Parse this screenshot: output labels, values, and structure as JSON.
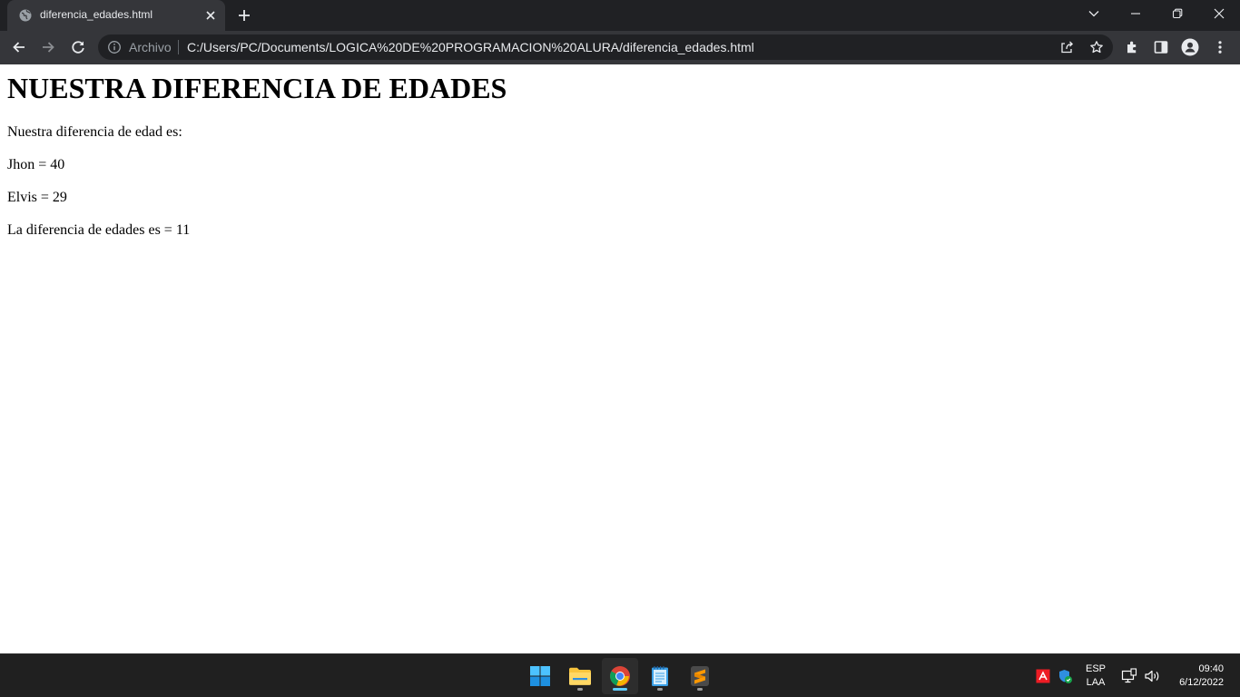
{
  "browser": {
    "tab": {
      "title": "diferencia_edades.html",
      "favicon": "globe-icon"
    },
    "omnibox": {
      "scheme_label": "Archivo",
      "url": "C:/Users/PC/Documents/LOGICA%20DE%20PROGRAMACION%20ALURA/diferencia_edades.html"
    }
  },
  "page": {
    "heading": "NUESTRA DIFERENCIA DE EDADES",
    "paragraphs": [
      "Nuestra diferencia de edad es:",
      "Jhon = 40",
      "Elvis = 29",
      "La diferencia de edades es = 11"
    ]
  },
  "taskbar": {
    "apps": [
      "windows-start-icon",
      "file-explorer-icon",
      "chrome-icon",
      "notepad-icon",
      "sublime-text-icon"
    ],
    "active_app": "chrome-icon",
    "language": {
      "line1": "ESP",
      "line2": "LAA"
    },
    "clock": {
      "time": "09:40",
      "date": "6/12/2022"
    }
  },
  "colors": {
    "tab_strip": "#202124",
    "toolbar": "#35363a",
    "omnibox": "#202124",
    "taskbar": "#202020",
    "active_indicator": "#60cdff"
  }
}
